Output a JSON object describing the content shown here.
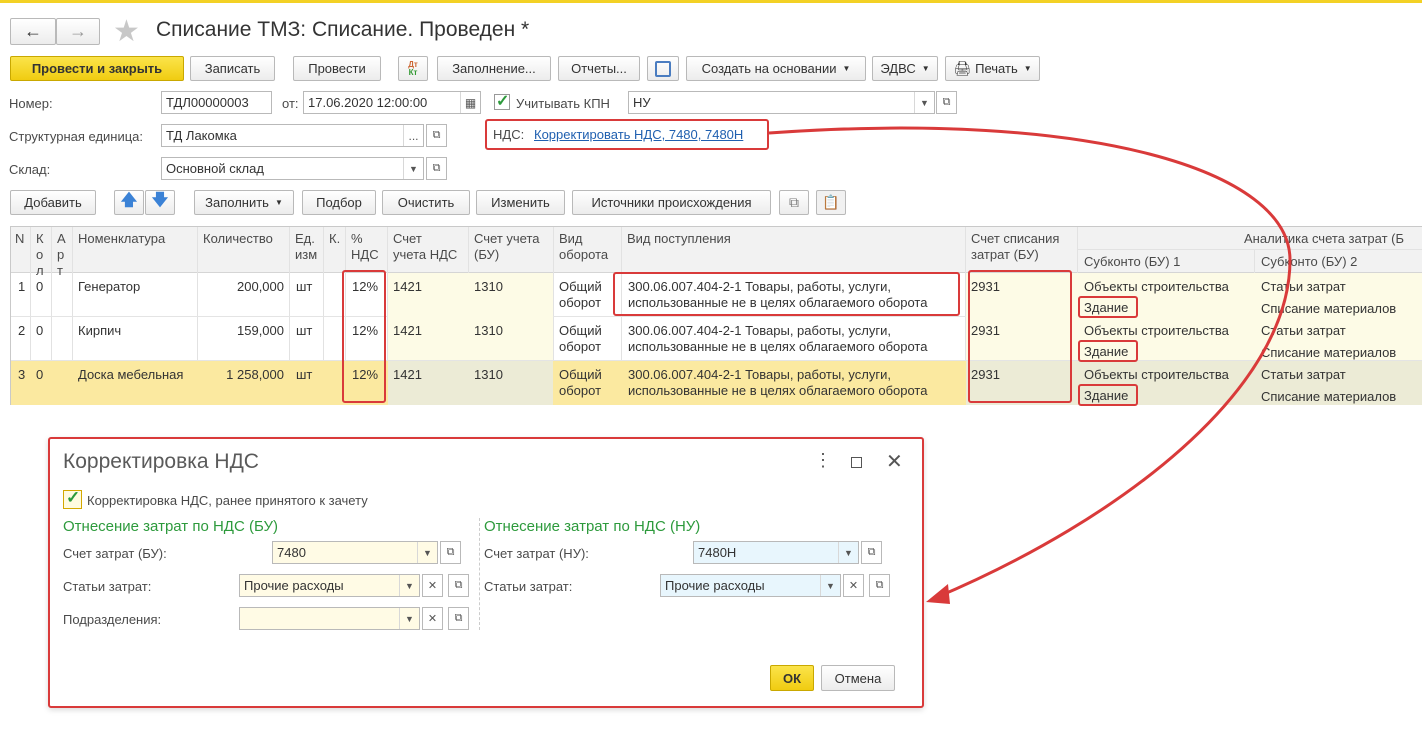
{
  "window": {
    "title": "Списание ТМЗ: Списание. Проведен *"
  },
  "toolbar": {
    "post_close": "Провести и закрыть",
    "save": "Записать",
    "post": "Провести",
    "dt_kt": "Дт Кт",
    "fill": "Заполнение...",
    "reports": "Отчеты...",
    "create_based": "Создать на основании",
    "edvs": "ЭДВС",
    "print": "Печать"
  },
  "header": {
    "number_label": "Номер:",
    "number_value": "ТДЛ00000003",
    "date_label": "от:",
    "date_value": "17.06.2020 12:00:00",
    "kpn_label": "Учитывать КПН",
    "kpn_value": "НУ",
    "struct_label": "Структурная единица:",
    "struct_value": "ТД Лакомка",
    "nds_label": "НДС:",
    "nds_link": "Корректировать НДС, 7480, 7480Н",
    "warehouse_label": "Склад:",
    "warehouse_value": "Основной склад"
  },
  "table_toolbar": {
    "add": "Добавить",
    "fill": "Заполнить",
    "pick": "Подбор",
    "clear": "Очистить",
    "change": "Изменить",
    "sources": "Источники происхождения"
  },
  "table": {
    "headers": {
      "n": "N",
      "kol1": "К",
      "kol2": "о",
      "kol3": "л",
      "art1": "А",
      "art2": "р",
      "art3": "т",
      "name": "Номенклатура",
      "qty": "Количество",
      "unit1": "Ед.",
      "unit2": "изм",
      "k": "К.",
      "nds1": "%",
      "nds2": "НДС",
      "acc_nds1": "Счет",
      "acc_nds2": "учета НДС",
      "acc_bu1": "Счет учета",
      "acc_bu2": "(БУ)",
      "turnover1": "Вид",
      "turnover2": "оборота",
      "receipt": "Вид поступления",
      "write_off1": "Счет списания",
      "write_off2": "затрат (БУ)",
      "analytics": "Аналитика счета затрат (Б",
      "sub1": "Субконто (БУ) 1",
      "sub2": "Субконто (БУ) 2"
    },
    "rows": [
      {
        "n": "1",
        "k": "0",
        "name": "Генератор",
        "qty": "200,000",
        "unit": "шт",
        "nds": "12%",
        "acc_nds": "1421",
        "acc_bu": "1310",
        "turnover1": "Общий",
        "turnover2": "оборот",
        "receipt1": "300.06.007.404-2-1 Товары, работы, услуги,",
        "receipt2": "использованные не в целях облагаемого оборота",
        "write_off": "2931",
        "sub1a": "Объекты строительства",
        "sub1b": "Здание",
        "sub2a": "Статьи затрат",
        "sub2b": "Списание материалов"
      },
      {
        "n": "2",
        "k": "0",
        "name": "Кирпич",
        "qty": "159,000",
        "unit": "шт",
        "nds": "12%",
        "acc_nds": "1421",
        "acc_bu": "1310",
        "turnover1": "Общий",
        "turnover2": "оборот",
        "receipt1": "300.06.007.404-2-1 Товары, работы, услуги,",
        "receipt2": "использованные не в целях облагаемого оборота",
        "write_off": "2931",
        "sub1a": "Объекты строительства",
        "sub1b": "Здание",
        "sub2a": "Статьи затрат",
        "sub2b": "Списание материалов"
      },
      {
        "n": "3",
        "k": "0",
        "name": "Доска мебельная",
        "qty": "1 258,000",
        "unit": "шт",
        "nds": "12%",
        "acc_nds": "1421",
        "acc_bu": "1310",
        "turnover1": "Общий",
        "turnover2": "оборот",
        "receipt1": "300.06.007.404-2-1 Товары, работы, услуги,",
        "receipt2": "использованные не в целях облагаемого оборота",
        "write_off": "2931",
        "sub1a": "Объекты строительства",
        "sub1b": "Здание",
        "sub2a": "Статьи затрат",
        "sub2b": "Списание материалов"
      }
    ]
  },
  "dialog": {
    "title": "Корректировка НДС",
    "checkbox_label": "Корректировка НДС, ранее принятого к зачету",
    "bu_section": "Отнесение затрат по НДС (БУ)",
    "nu_section": "Отнесение затрат по НДС (НУ)",
    "bu_account_label": "Счет затрат (БУ):",
    "bu_account_value": "7480",
    "bu_items_label": "Статьи затрат:",
    "bu_items_value": "Прочие расходы",
    "bu_division_label": "Подразделения:",
    "bu_division_value": "",
    "nu_account_label": "Счет затрат (НУ):",
    "nu_account_value": "7480Н",
    "nu_items_label": "Статьи затрат:",
    "nu_items_value": "Прочие расходы",
    "ok": "ОК",
    "cancel": "Отмена"
  },
  "colors": {
    "accent": "#f3d125",
    "annotation": "#d93a3a",
    "link": "#2060b0",
    "section": "#2d9a3c",
    "row_highlight": "#fbe9a0"
  }
}
